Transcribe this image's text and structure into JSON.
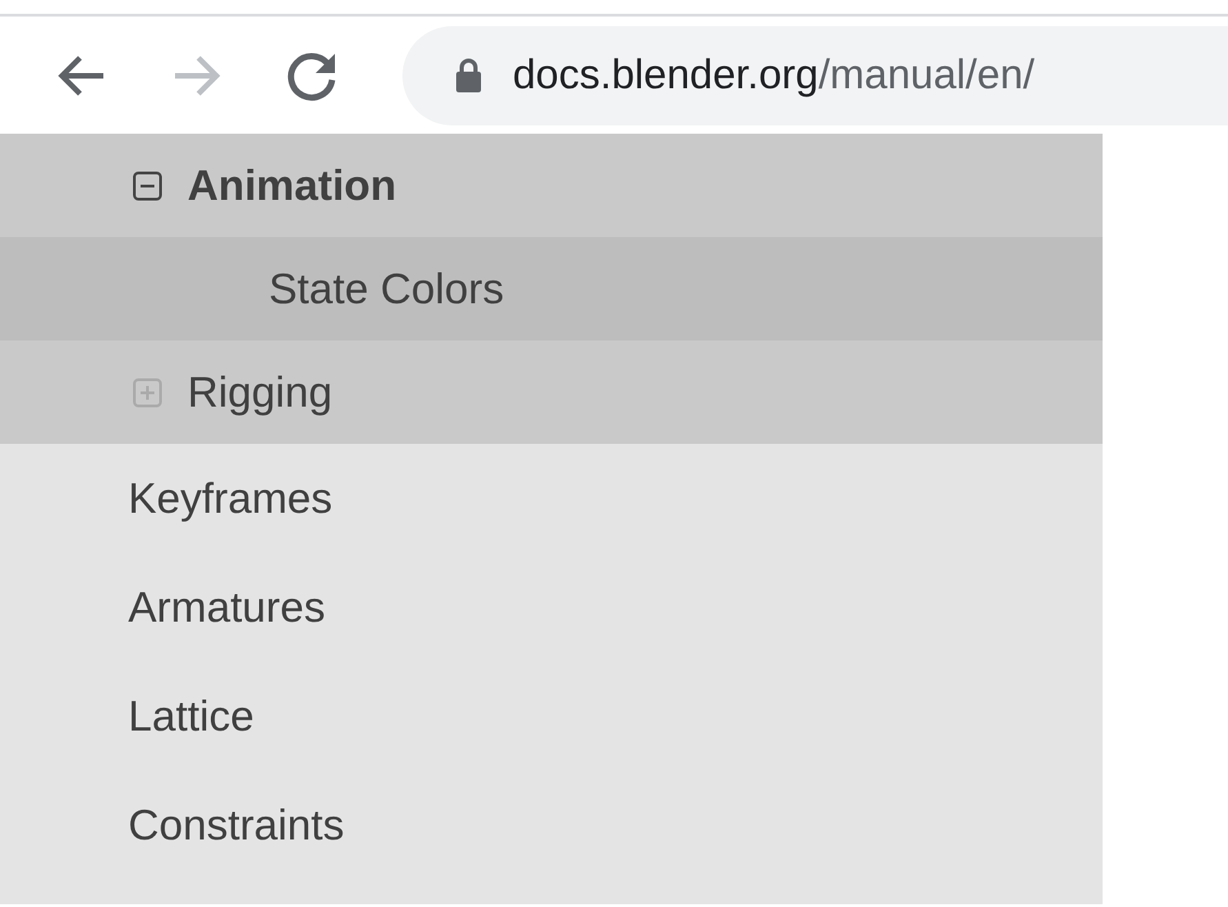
{
  "browser": {
    "back_disabled": false,
    "forward_disabled": true,
    "url_host": "docs.blender.org",
    "url_path": "/manual/en/"
  },
  "sidebar": {
    "items": [
      {
        "kind": "subsection",
        "label": "Animation",
        "expanded": true,
        "selected": false,
        "children": [
          {
            "label": "State Colors",
            "selected": true
          }
        ]
      },
      {
        "kind": "subsection",
        "label": "Rigging",
        "expanded": false,
        "selected": false
      },
      {
        "kind": "section",
        "label": "Keyframes",
        "selected": false
      },
      {
        "kind": "section",
        "label": "Armatures",
        "selected": false
      },
      {
        "kind": "section",
        "label": "Lattice",
        "selected": false
      },
      {
        "kind": "section",
        "label": "Constraints",
        "selected": false
      }
    ]
  }
}
